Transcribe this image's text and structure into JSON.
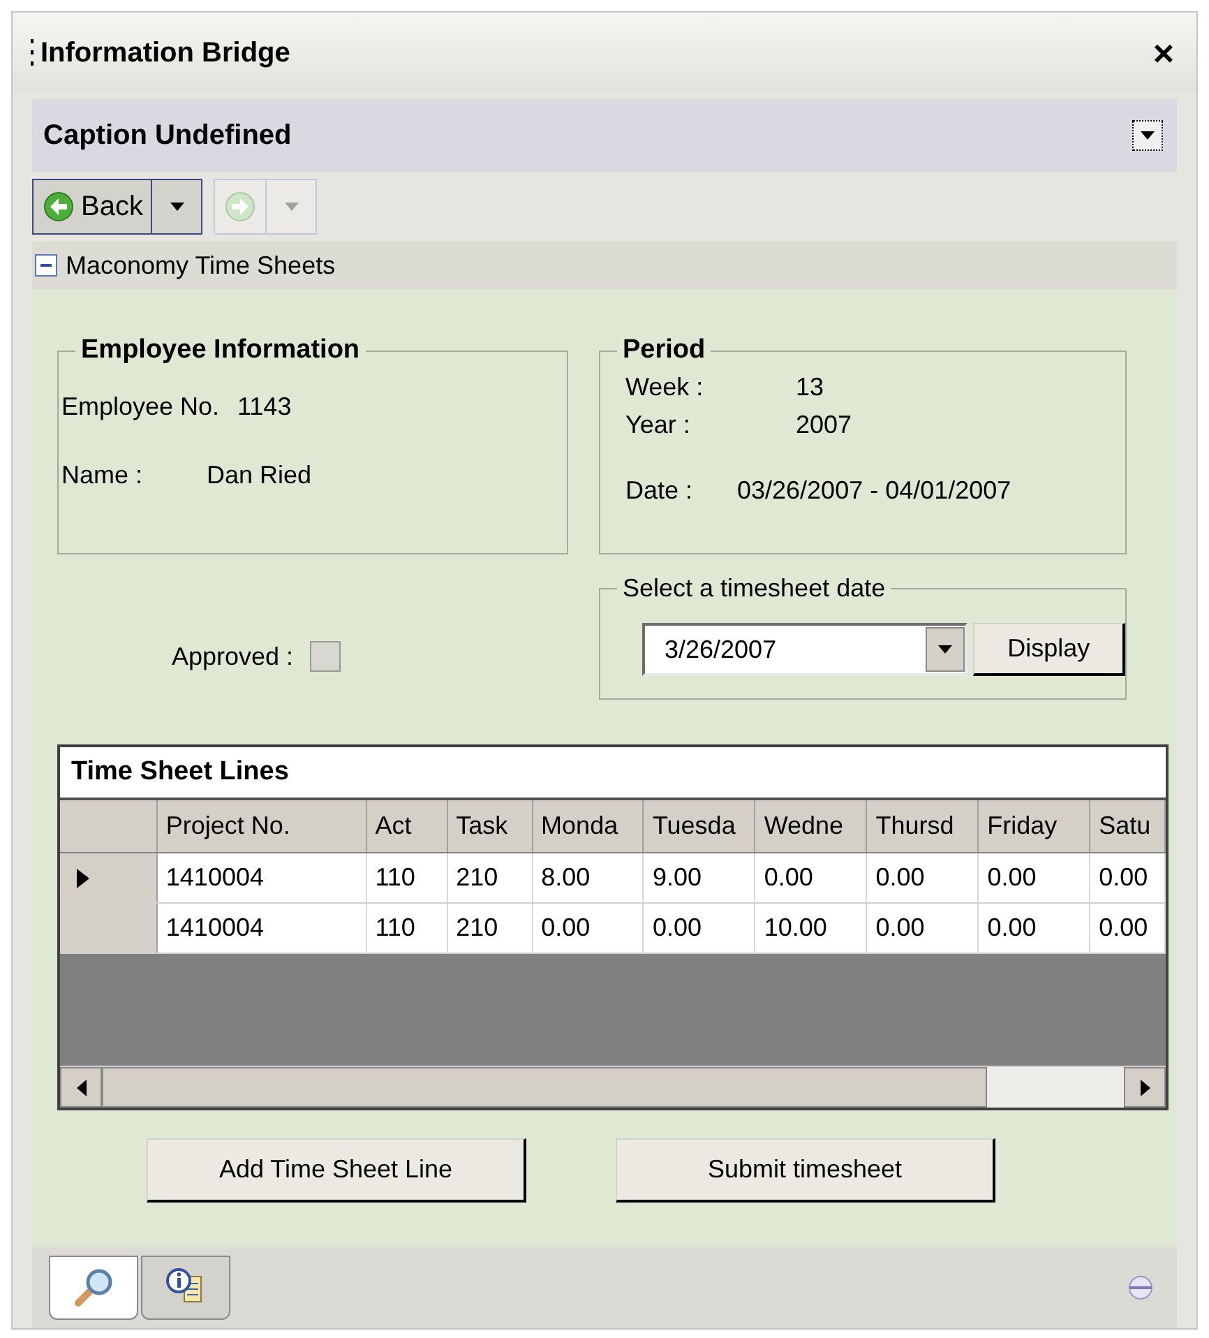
{
  "window": {
    "title": "Information Bridge",
    "close": "×"
  },
  "caption": "Caption Undefined",
  "toolbar": {
    "back": "Back",
    "forward_disabled": true
  },
  "section": {
    "title": "Maconomy Time Sheets",
    "expanded": true
  },
  "employee": {
    "title": "Employee Information",
    "fields": [
      {
        "label": "Employee No.",
        "value": "1143"
      },
      {
        "label": "Name :",
        "value": "Dan Ried"
      }
    ]
  },
  "period": {
    "title": "Period",
    "fields": [
      {
        "label": "Week :",
        "value": "13"
      },
      {
        "label": "Year :",
        "value": "2007"
      },
      {
        "label": "Date :",
        "value": "03/26/2007 - 04/01/2007"
      }
    ]
  },
  "approved": {
    "label": "Approved :",
    "checked": false,
    "disabled": true
  },
  "date_picker": {
    "title": "Select a timesheet date",
    "value": "3/26/2007",
    "button": "Display"
  },
  "table": {
    "title": "Time Sheet Lines",
    "columns": [
      "Project No.",
      "Act",
      "Task",
      "Monda",
      "Tuesda",
      "Wedne",
      "Thursd",
      "Friday",
      "Satu"
    ],
    "rows": [
      {
        "selected": true,
        "cells": [
          "1410004",
          "110",
          "210",
          "8.00",
          "9.00",
          "0.00",
          "0.00",
          "0.00",
          "0.00"
        ]
      },
      {
        "selected": false,
        "cells": [
          "1410004",
          "110",
          "210",
          "0.00",
          "0.00",
          "10.00",
          "0.00",
          "0.00",
          "0.00"
        ]
      }
    ]
  },
  "buttons": [
    "Add Time Sheet Line",
    "Submit timesheet"
  ],
  "bottom_tabs": [
    {
      "kind": "search",
      "selected": true
    },
    {
      "kind": "info",
      "selected": false
    }
  ]
}
